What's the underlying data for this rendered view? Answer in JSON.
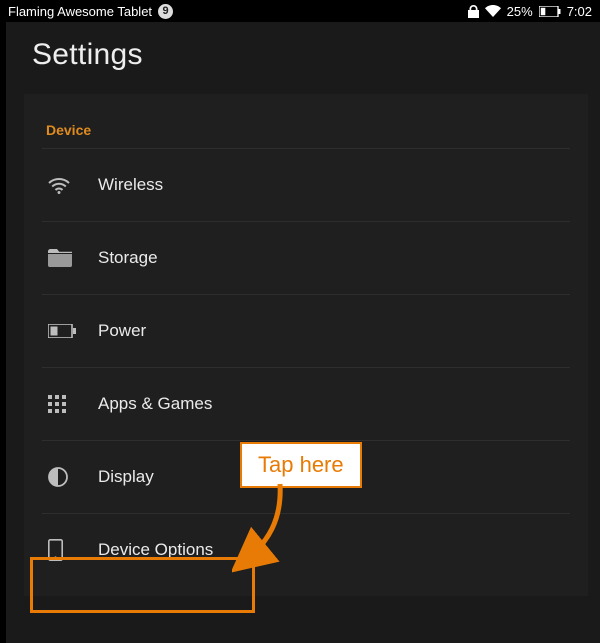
{
  "status": {
    "device_name": "Flaming Awesome Tablet",
    "notification_count": "9",
    "battery_percent": "25%",
    "time": "7:02"
  },
  "header": {
    "title": "Settings"
  },
  "section": {
    "title": "Device"
  },
  "items": [
    {
      "label": "Wireless",
      "icon": "wifi"
    },
    {
      "label": "Storage",
      "icon": "folder"
    },
    {
      "label": "Power",
      "icon": "battery"
    },
    {
      "label": "Apps & Games",
      "icon": "grid"
    },
    {
      "label": "Display",
      "icon": "contrast"
    },
    {
      "label": "Device Options",
      "icon": "phone"
    }
  ],
  "annotation": {
    "label": "Tap here"
  },
  "colors": {
    "accent": "#e87b05",
    "section_title": "#e08b1e"
  }
}
